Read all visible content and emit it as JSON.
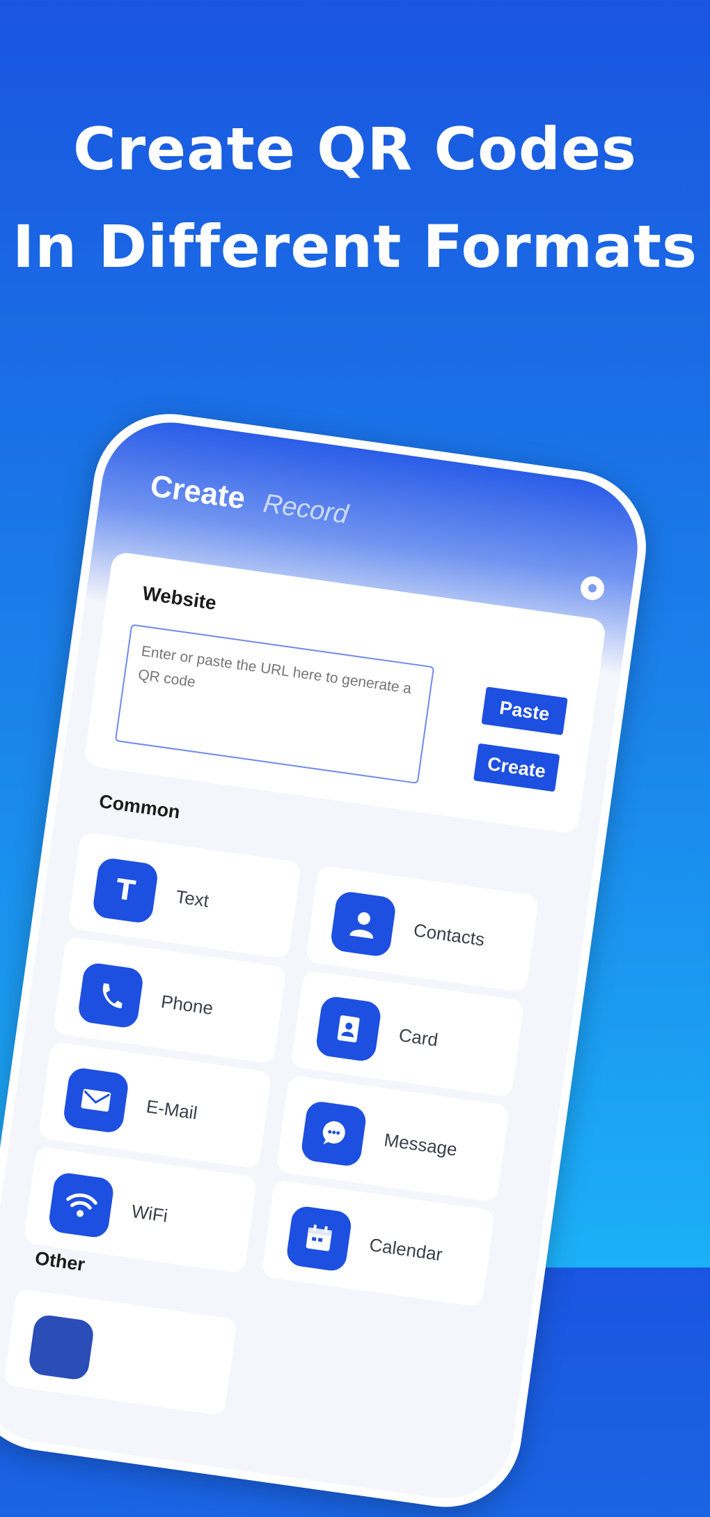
{
  "headline": {
    "line1": "Create QR Codes",
    "line2": "In Different Formats"
  },
  "app": {
    "tabs": {
      "active": "Create",
      "inactive": "Record"
    },
    "website": {
      "title": "Website",
      "input_placeholder": "Enter or paste the URL here to generate a QR code",
      "paste_label": "Paste",
      "create_label": "Create"
    },
    "common_label": "Common",
    "items": [
      {
        "label": "Text",
        "icon": "text-icon"
      },
      {
        "label": "Contacts",
        "icon": "contacts-icon"
      },
      {
        "label": "Phone",
        "icon": "phone-icon"
      },
      {
        "label": "Card",
        "icon": "card-icon"
      },
      {
        "label": "E-Mail",
        "icon": "mail-icon"
      },
      {
        "label": "Message",
        "icon": "message-icon"
      },
      {
        "label": "WiFi",
        "icon": "wifi-icon"
      },
      {
        "label": "Calendar",
        "icon": "calendar-icon"
      }
    ],
    "other_label": "Other"
  },
  "colors": {
    "background_top": "#1a55e0",
    "background_bottom": "#1cb0f8",
    "accent": "#1d4fe0"
  }
}
